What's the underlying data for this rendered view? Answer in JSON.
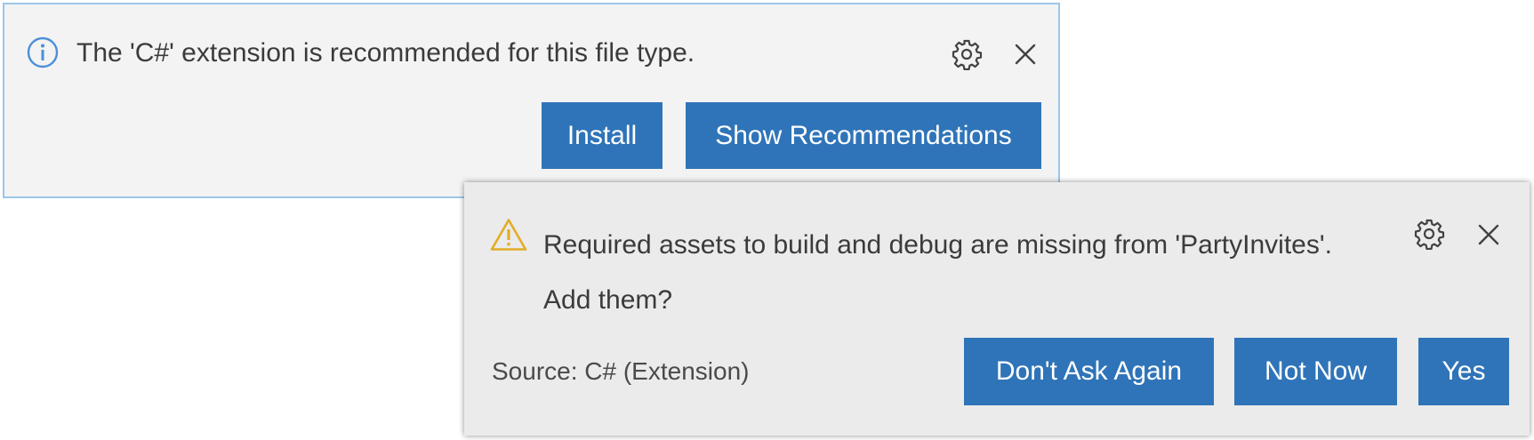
{
  "colors": {
    "button_bg": "#2f74b8",
    "button_text": "#ffffff",
    "info_icon": "#4a90d9",
    "warning_icon": "#e2ad27",
    "toast_1_border": "#9cc6ea",
    "toast_1_bg": "#f3f3f3",
    "toast_2_bg": "#ebebeb"
  },
  "notification_1": {
    "icon": "info-icon",
    "message": "The 'C#' extension is recommended for this file type.",
    "settings_icon": "gear-icon",
    "close_icon": "close-icon",
    "actions": {
      "install": "Install",
      "show_recommendations": "Show Recommendations"
    }
  },
  "notification_2": {
    "icon": "warning-icon",
    "message": "Required assets to build and debug are missing from 'PartyInvites'. Add them?",
    "settings_icon": "gear-icon",
    "close_icon": "close-icon",
    "source": "Source: C# (Extension)",
    "actions": {
      "dont_ask_again": "Don't Ask Again",
      "not_now": "Not Now",
      "yes": "Yes"
    }
  }
}
